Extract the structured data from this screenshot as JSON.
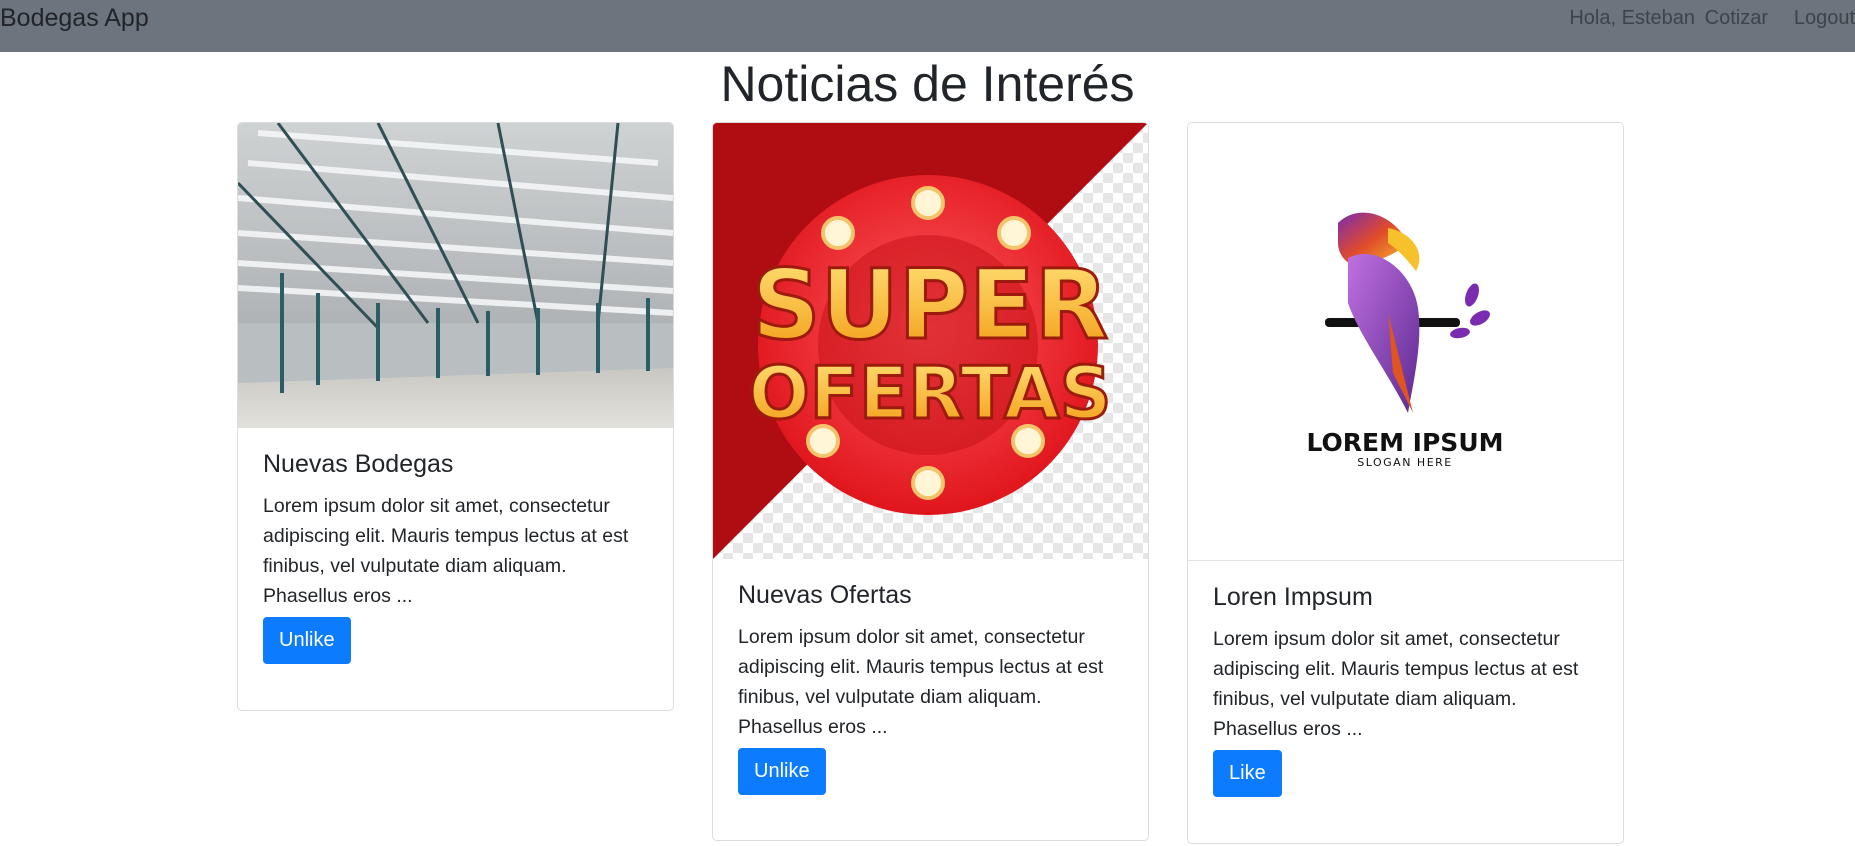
{
  "navbar": {
    "brand": "Bodegas App",
    "greeting": "Hola, Esteban",
    "cotizar": "Cotizar",
    "logout": "Logout"
  },
  "page": {
    "title": "Noticias de Interés"
  },
  "cards": [
    {
      "title": "Nuevas Bodegas",
      "text": "Lorem ipsum dolor sit amet, consectetur adipiscing elit. Mauris tempus lectus at est finibus, vel vulputate diam aliquam. Phasellus eros ...",
      "button": "Unlike",
      "image": "warehouse-interior-photo"
    },
    {
      "title": "Nuevas Ofertas",
      "text": "Lorem ipsum dolor sit amet, consectetur adipiscing elit. Mauris tempus lectus at est finibus, vel vulputate diam aliquam. Phasellus eros ...",
      "button": "Unlike",
      "image": "super-ofertas-graphic",
      "image_text_1": "SUPER",
      "image_text_2": "OFERTAS"
    },
    {
      "title": "Loren Impsum",
      "text": "Lorem ipsum dolor sit amet, consectetur adipiscing elit. Mauris tempus lectus at est finibus, vel vulputate diam aliquam. Phasellus eros ...",
      "button": "Like",
      "image": "bird-logo",
      "logo_text": "LOREM IPSUM",
      "logo_slogan": "SLOGAN HERE"
    }
  ],
  "colors": {
    "navbar": "#6c757d",
    "button": "#0d7bfe",
    "promo_red": "#d7141c",
    "promo_gold": "#f7b42c"
  }
}
